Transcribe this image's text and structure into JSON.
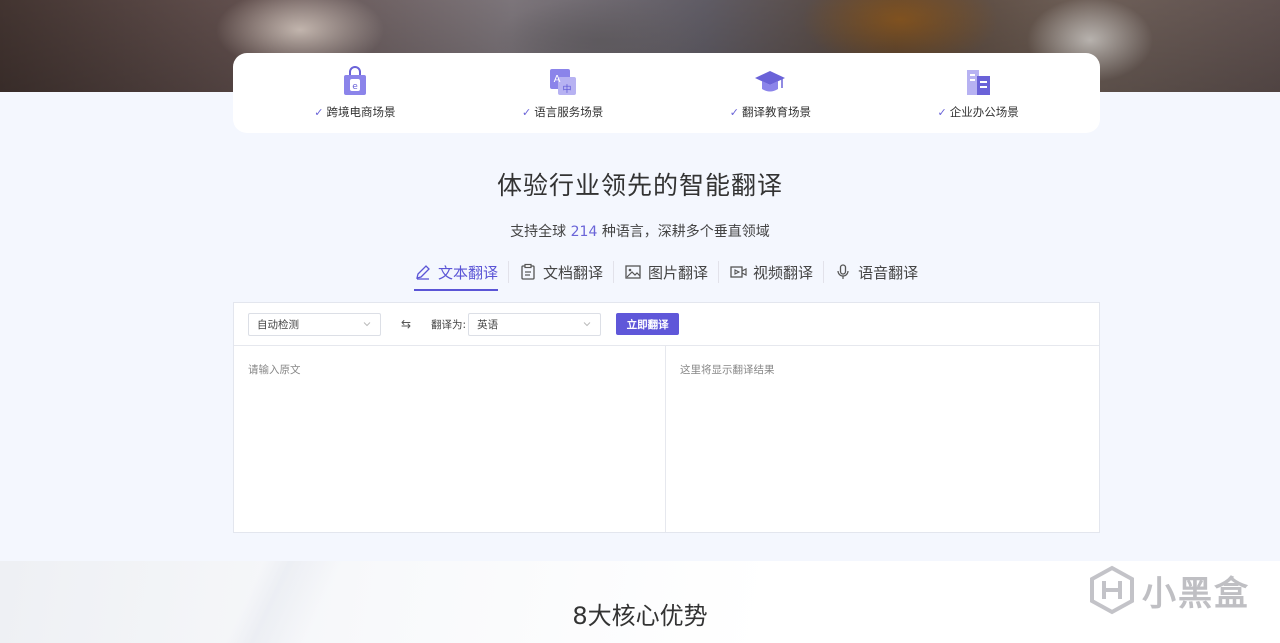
{
  "scenes": [
    {
      "label": "跨境电商场景",
      "icon": "shopping-bag-icon"
    },
    {
      "label": "语言服务场景",
      "icon": "language-translate-icon"
    },
    {
      "label": "翻译教育场景",
      "icon": "graduation-cap-icon"
    },
    {
      "label": "企业办公场景",
      "icon": "office-building-icon"
    }
  ],
  "check_mark": "✓",
  "title": "体验行业领先的智能翻译",
  "subtitle": {
    "prefix": "支持全球",
    "count": "214",
    "suffix": "种语言，深耕多个垂直领域"
  },
  "tabs": [
    {
      "label": "文本翻译",
      "icon": "pencil-icon",
      "active": true
    },
    {
      "label": "文档翻译",
      "icon": "document-icon",
      "active": false
    },
    {
      "label": "图片翻译",
      "icon": "image-icon",
      "active": false
    },
    {
      "label": "视频翻译",
      "icon": "video-icon",
      "active": false
    },
    {
      "label": "语音翻译",
      "icon": "microphone-icon",
      "active": false
    }
  ],
  "translator": {
    "source_lang": "自动检测",
    "swap_symbol": "⇆",
    "target_label": "翻译为:",
    "target_lang": "英语",
    "submit_label": "立即翻译",
    "input_placeholder": "请输入原文",
    "output_placeholder": "这里将显示翻译结果"
  },
  "section_title": "8大核心优势",
  "watermark": "小黑盒",
  "colors": {
    "accent": "#5b55d6",
    "button": "#5f57d9"
  }
}
